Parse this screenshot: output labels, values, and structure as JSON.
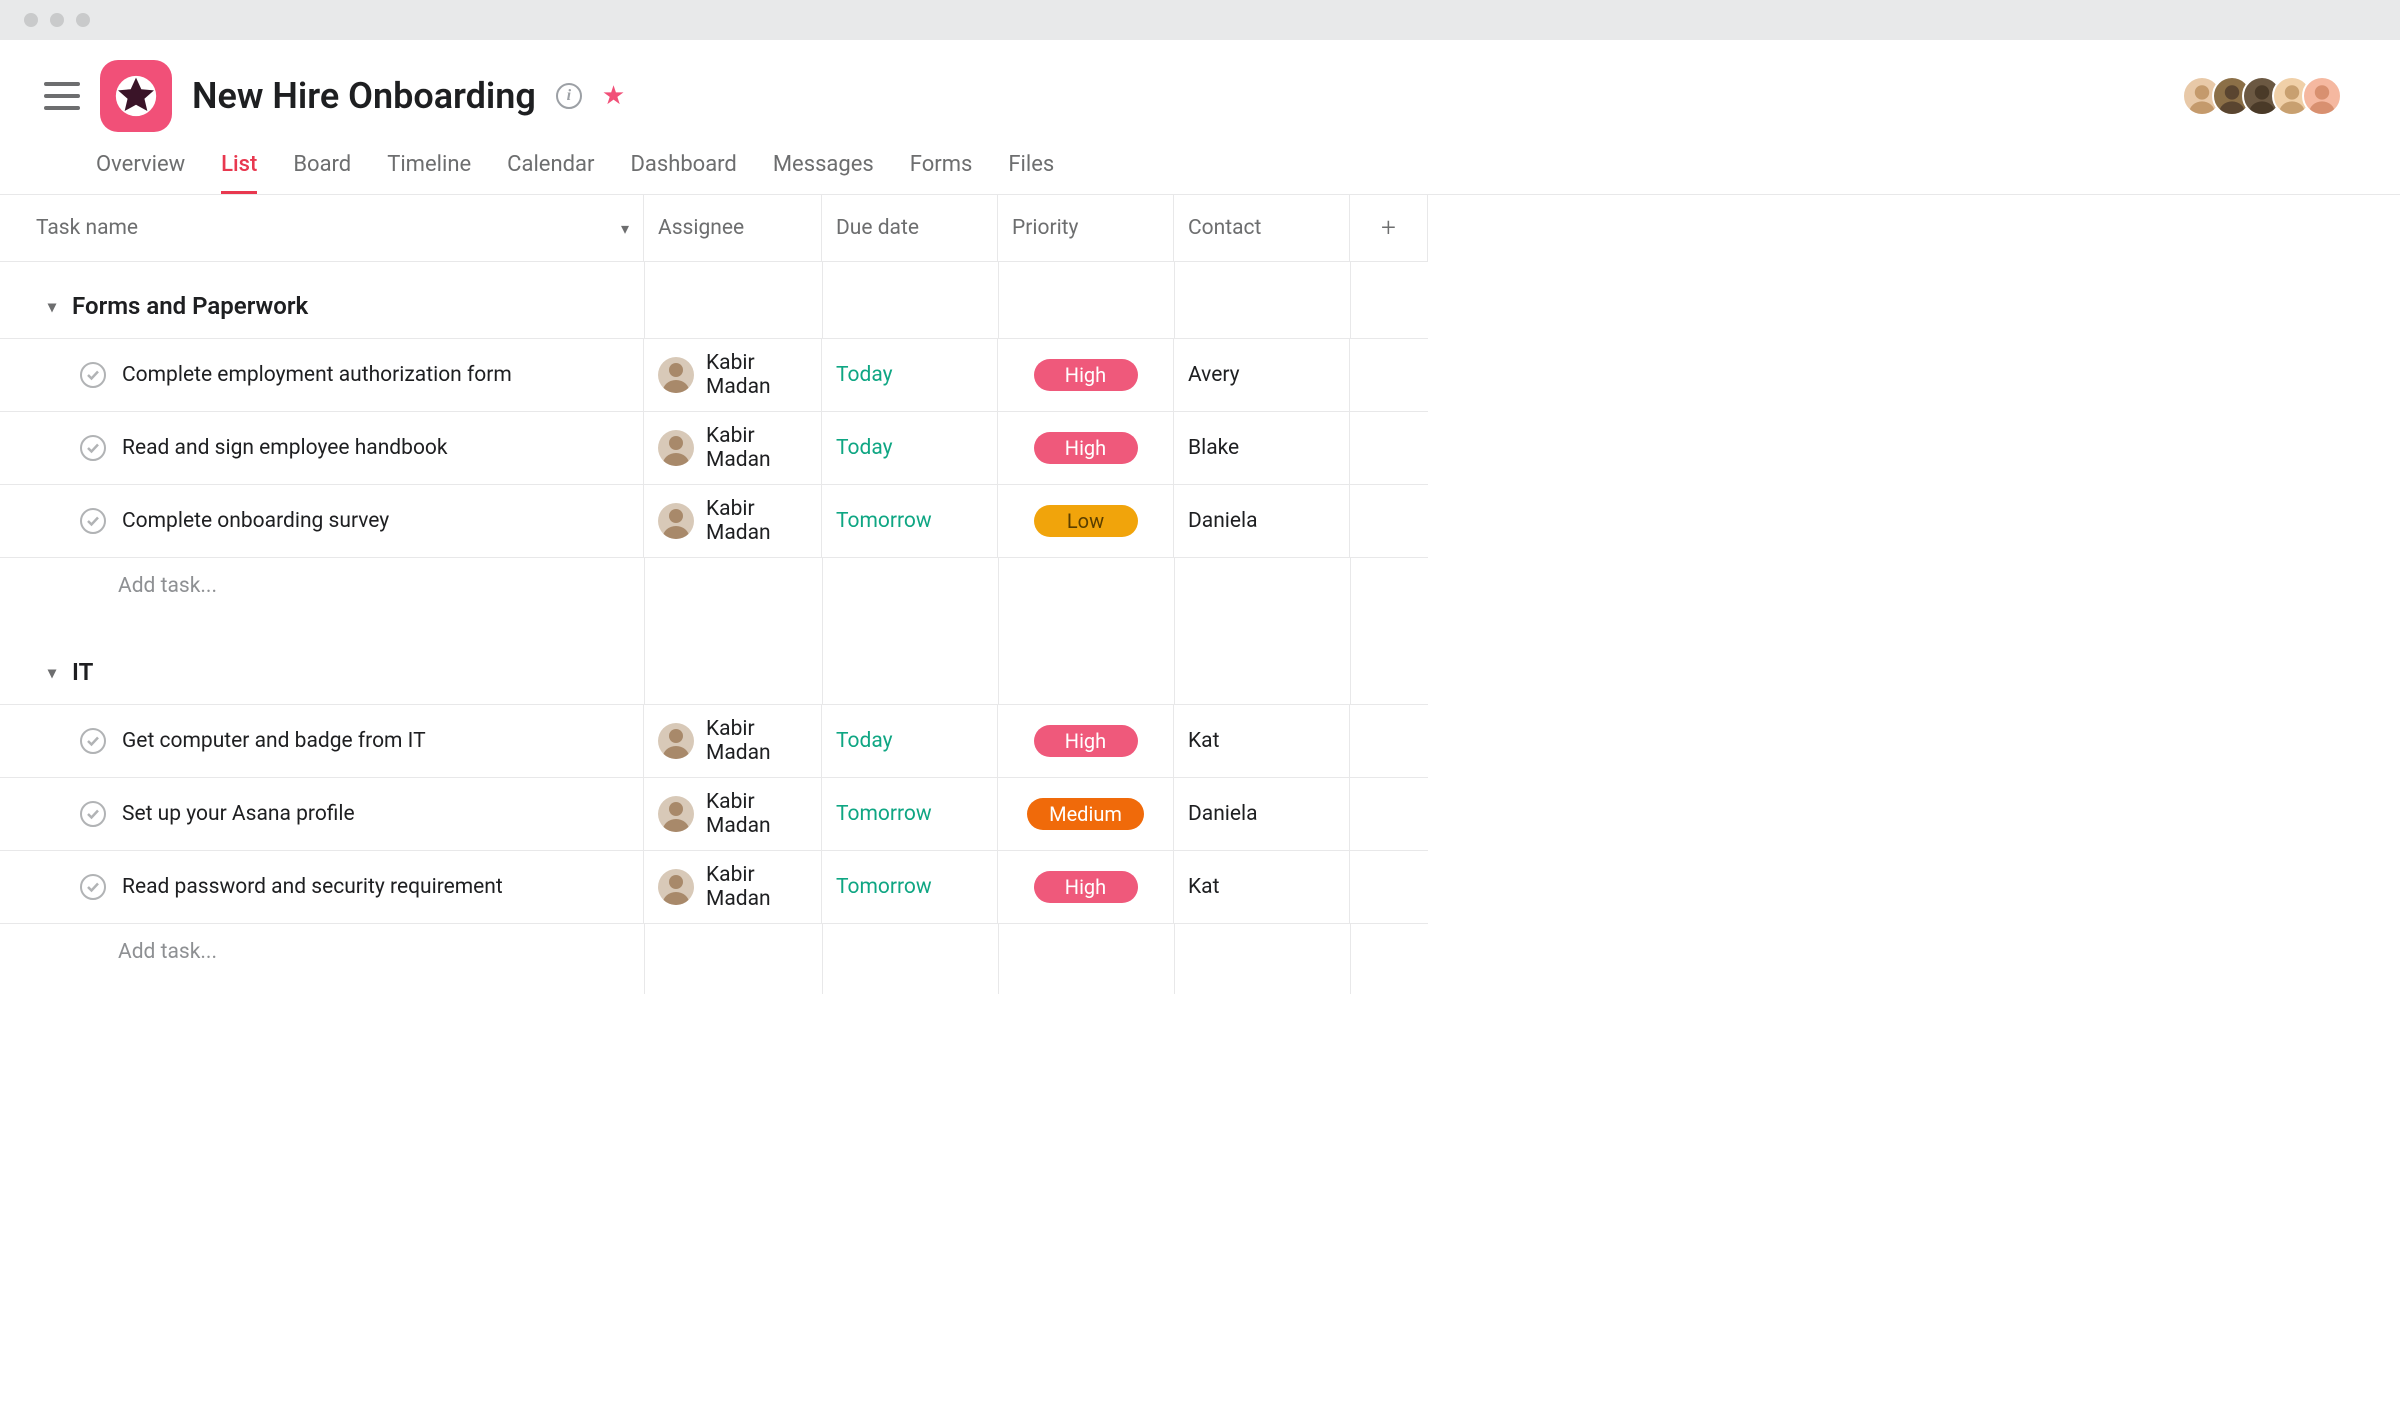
{
  "project": {
    "title": "New Hire Onboarding",
    "starred": true
  },
  "tabs": [
    {
      "label": "Overview",
      "active": false
    },
    {
      "label": "List",
      "active": true
    },
    {
      "label": "Board",
      "active": false
    },
    {
      "label": "Timeline",
      "active": false
    },
    {
      "label": "Calendar",
      "active": false
    },
    {
      "label": "Dashboard",
      "active": false
    },
    {
      "label": "Messages",
      "active": false
    },
    {
      "label": "Forms",
      "active": false
    },
    {
      "label": "Files",
      "active": false
    }
  ],
  "columns": {
    "task_name": "Task name",
    "assignee": "Assignee",
    "due_date": "Due date",
    "priority": "Priority",
    "contact": "Contact",
    "add": "+"
  },
  "add_task_label": "Add task...",
  "sections": [
    {
      "title": "Forms and Paperwork",
      "tasks": [
        {
          "name": "Complete employment authorization form",
          "assignee": "Kabir Madan",
          "due": "Today",
          "due_class": "due-today",
          "priority": "High",
          "priority_class": "prio-high",
          "contact": "Avery"
        },
        {
          "name": "Read and sign employee handbook",
          "assignee": "Kabir Madan",
          "due": "Today",
          "due_class": "due-today",
          "priority": "High",
          "priority_class": "prio-high",
          "contact": "Blake"
        },
        {
          "name": "Complete onboarding survey",
          "assignee": "Kabir Madan",
          "due": "Tomorrow",
          "due_class": "due-tomorrow",
          "priority": "Low",
          "priority_class": "prio-low",
          "contact": "Daniela"
        }
      ]
    },
    {
      "title": "IT",
      "tasks": [
        {
          "name": "Get computer and badge from IT",
          "assignee": "Kabir Madan",
          "due": "Today",
          "due_class": "due-today",
          "priority": "High",
          "priority_class": "prio-high",
          "contact": "Kat"
        },
        {
          "name": "Set up your Asana profile",
          "assignee": "Kabir Madan",
          "due": "Tomorrow",
          "due_class": "due-tomorrow",
          "priority": "Medium",
          "priority_class": "prio-medium",
          "contact": "Daniela"
        },
        {
          "name": "Read password and security requirement",
          "assignee": "Kabir Madan",
          "due": "Tomorrow",
          "due_class": "due-tomorrow",
          "priority": "High",
          "priority_class": "prio-high",
          "contact": "Kat"
        }
      ]
    }
  ],
  "collaborators_count": 5,
  "colors": {
    "accent": "#f15078",
    "tab_active": "#e8384f",
    "due_green": "#0fa683"
  }
}
